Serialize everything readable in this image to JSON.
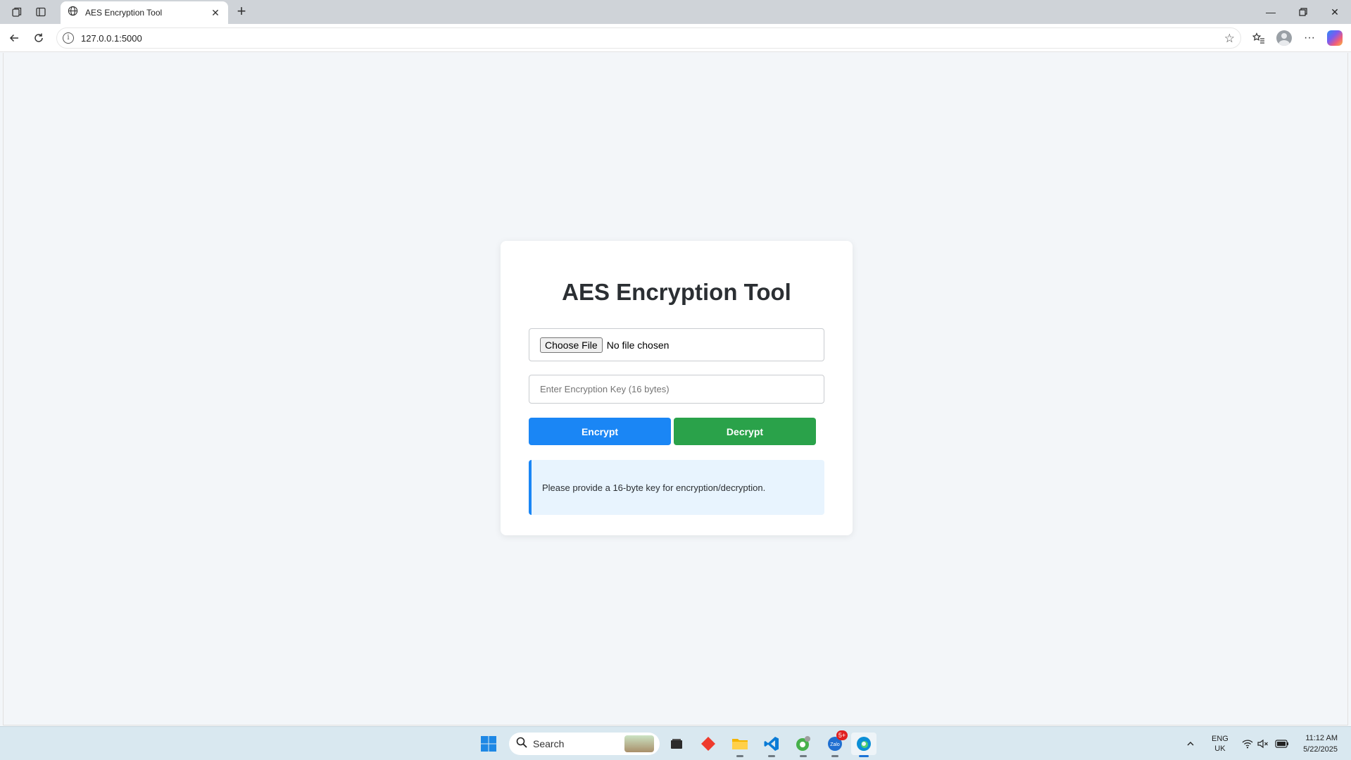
{
  "browser": {
    "tab_title": "AES Encryption Tool",
    "url": "127.0.0.1:5000"
  },
  "page": {
    "title": "AES Encryption Tool",
    "file_button": "Choose File",
    "file_status": "No file chosen",
    "key_placeholder": "Enter Encryption Key (16 bytes)",
    "encrypt_label": "Encrypt",
    "decrypt_label": "Decrypt",
    "message": "Please provide a 16-byte key for encryption/decryption."
  },
  "colors": {
    "encrypt": "#1a86f5",
    "decrypt": "#2aa24a",
    "message_bg": "#e8f4fe"
  },
  "taskbar": {
    "search_label": "Search",
    "mail_badge": "5+",
    "lang_top": "ENG",
    "lang_bottom": "UK",
    "time": "11:12 AM",
    "date": "5/22/2025"
  }
}
